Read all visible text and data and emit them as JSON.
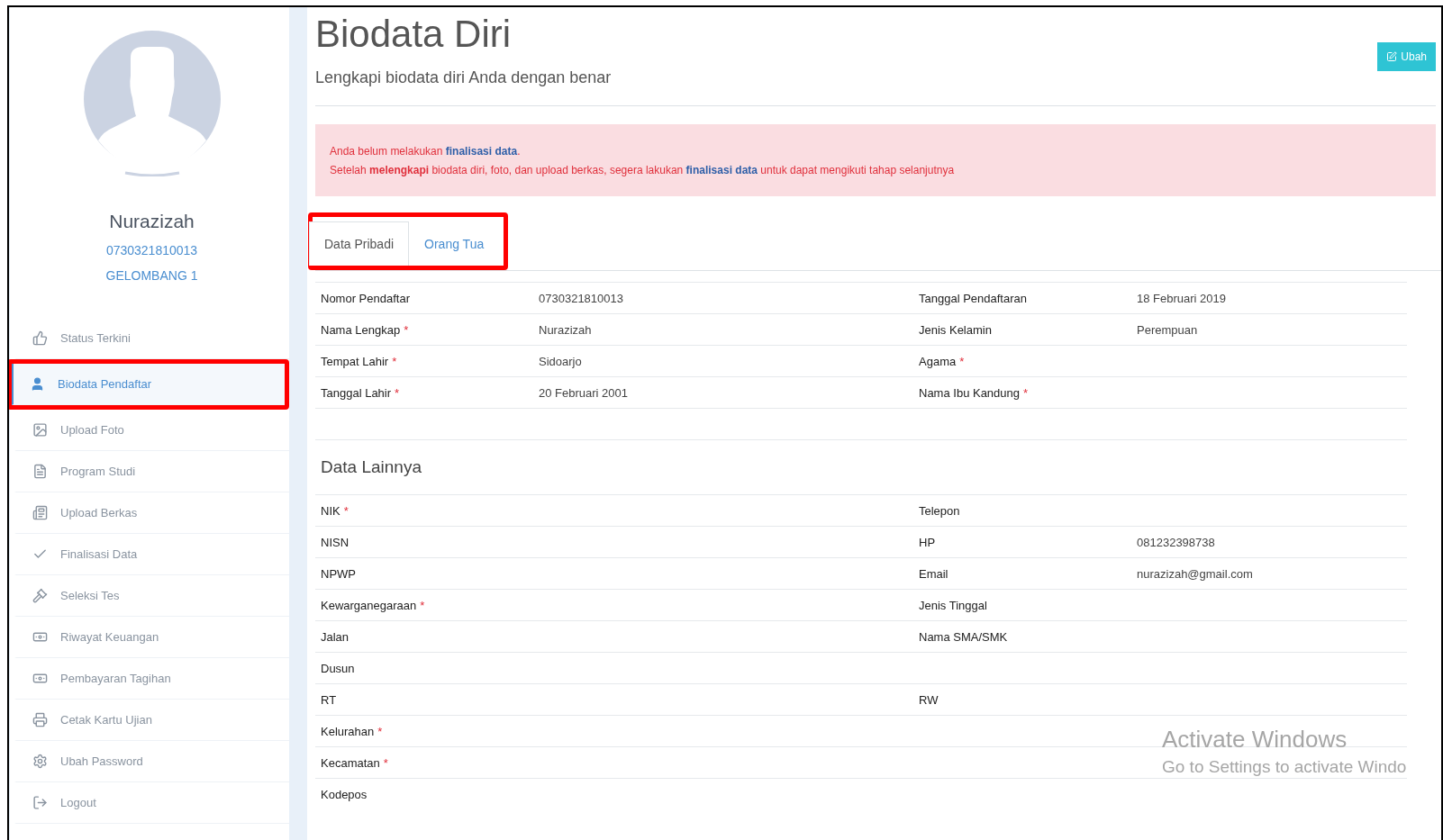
{
  "profile": {
    "name": "Nurazizah",
    "number": "0730321810013",
    "wave": "GELOMBANG 1"
  },
  "sidebar": {
    "items": [
      {
        "label": "Status Terkini",
        "selected": false,
        "highlighted": false
      },
      {
        "label": "Biodata Pendaftar",
        "selected": true,
        "highlighted": true
      },
      {
        "label": "Upload Foto",
        "selected": false,
        "highlighted": false
      },
      {
        "label": "Program Studi",
        "selected": false,
        "highlighted": false
      },
      {
        "label": "Upload Berkas",
        "selected": false,
        "highlighted": false
      },
      {
        "label": "Finalisasi Data",
        "selected": false,
        "highlighted": false
      },
      {
        "label": "Seleksi Tes",
        "selected": false,
        "highlighted": false
      },
      {
        "label": "Riwayat Keuangan",
        "selected": false,
        "highlighted": false
      },
      {
        "label": "Pembayaran Tagihan",
        "selected": false,
        "highlighted": false
      },
      {
        "label": "Cetak Kartu Ujian",
        "selected": false,
        "highlighted": false
      },
      {
        "label": "Ubah Password",
        "selected": false,
        "highlighted": false
      },
      {
        "label": "Logout",
        "selected": false,
        "highlighted": false
      }
    ]
  },
  "header": {
    "title": "Biodata Diri",
    "subtitle": "Lengkapi biodata diri Anda dengan benar",
    "edit_button": "Ubah"
  },
  "alert": {
    "lines": [
      {
        "segments": [
          {
            "text": "Anda belum melakukan ",
            "kind": "plain"
          },
          {
            "text": "finalisasi data",
            "kind": "link"
          },
          {
            "text": ".",
            "kind": "plain"
          }
        ]
      },
      {
        "segments": [
          {
            "text": "Setelah ",
            "kind": "plain"
          },
          {
            "text": "melengkapi",
            "kind": "strong"
          },
          {
            "text": " biodata diri, foto, dan upload berkas, segera lakukan ",
            "kind": "plain"
          },
          {
            "text": "finalisasi data",
            "kind": "link"
          },
          {
            "text": " untuk dapat mengikuti tahap selanjutnya",
            "kind": "plain"
          }
        ]
      }
    ]
  },
  "tabs": {
    "highlighted": true,
    "items": [
      {
        "label": "Data Pribadi",
        "selected": true
      },
      {
        "label": "Orang Tua",
        "selected": false
      }
    ]
  },
  "personal": [
    {
      "left": {
        "label": "Nomor Pendaftar",
        "value": "0730321810013"
      },
      "right": {
        "label": "Tanggal Pendaftaran",
        "value": "18 Februari 2019"
      }
    },
    {
      "left": {
        "label": "Nama Lengkap",
        "mark": "*",
        "value": "Nurazizah"
      },
      "right": {
        "label": "Jenis Kelamin",
        "value": "Perempuan"
      }
    },
    {
      "left": {
        "label": "Tempat Lahir",
        "mark": "*",
        "value": "Sidoarjo"
      },
      "right": {
        "label": "Agama",
        "mark": "*"
      }
    },
    {
      "left": {
        "label": "Tanggal Lahir",
        "mark": "*",
        "value": "20 Februari 2001"
      },
      "right": {
        "label": "Nama Ibu Kandung",
        "mark": "*"
      }
    }
  ],
  "other": {
    "title": "Data Lainnya",
    "rows": [
      {
        "left": {
          "label": "NIK",
          "mark": "*"
        },
        "right": {
          "label": "Telepon"
        }
      },
      {
        "left": {
          "label": "NISN"
        },
        "right": {
          "label": "HP",
          "value": "081232398738"
        }
      },
      {
        "left": {
          "label": "NPWP"
        },
        "right": {
          "label": "Email",
          "value": "nurazizah@gmail.com"
        }
      },
      {
        "left": {
          "label": "Kewarganegaraan",
          "mark": "*"
        },
        "right": {
          "label": "Jenis Tinggal"
        }
      },
      {
        "left": {
          "label": "Jalan"
        },
        "right": {
          "label": "Nama SMA/SMK"
        }
      },
      {
        "left": {
          "label": "Dusun"
        }
      },
      {
        "left": {
          "label": "RT"
        },
        "right": {
          "label": "RW"
        }
      },
      {
        "left": {
          "label": "Kelurahan",
          "mark": "*"
        }
      },
      {
        "left": {
          "label": "Kecamatan",
          "mark": "*"
        }
      },
      {
        "left": {
          "label": "Kodepos"
        }
      }
    ]
  },
  "os_notice": {
    "title": "Activate Windows",
    "text": "Go to Settings to activate Windo"
  }
}
